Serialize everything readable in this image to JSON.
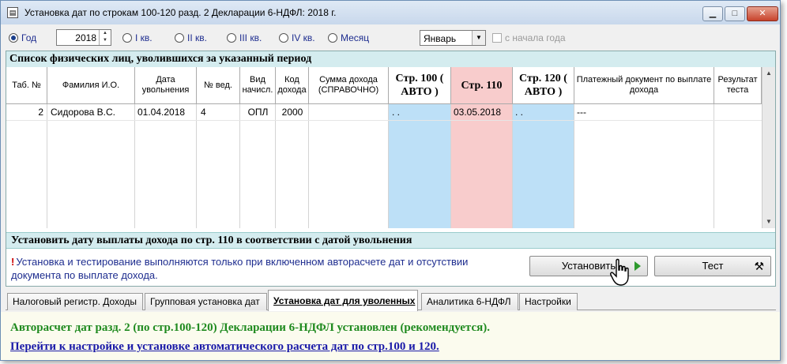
{
  "window": {
    "title": "Установка дат по строкам 100-120 разд. 2 Декларации 6-НДФЛ: 2018 г.",
    "minimize_glyph": "▁",
    "maximize_glyph": "□",
    "close_glyph": "✕"
  },
  "period": {
    "options": [
      {
        "label": "Год",
        "selected": true
      },
      {
        "label": "I кв.",
        "selected": false
      },
      {
        "label": "II кв.",
        "selected": false
      },
      {
        "label": "III кв.",
        "selected": false
      },
      {
        "label": "IV кв.",
        "selected": false
      },
      {
        "label": "Месяц",
        "selected": false
      }
    ],
    "year": "2018",
    "month": "Январь",
    "from_start_label": "с начала года",
    "from_start_checked": false
  },
  "list": {
    "title": "Список физических лиц, уволившихся за указанный период",
    "columns": [
      "Таб. №",
      "Фамилия И.О.",
      "Дата увольнения",
      "№ вед.",
      "Вид начисл.",
      "Код дохода",
      "Сумма дохода (СПРАВОЧНО)",
      "Стр. 100 ( АВТО )",
      "Стр. 110",
      "Стр. 120 ( АВТО )",
      "Платежный документ по выплате дохода",
      "Результат теста"
    ],
    "rows": [
      {
        "tab_no": "2",
        "name": "Сидорова В.С.",
        "dismissal_date": "01.04.2018",
        "ved_no": "4",
        "accrual_type": "ОПЛ",
        "income_code": "2000",
        "income_sum": "",
        "line100": ". .",
        "line110": "03.05.2018",
        "line120": ". .",
        "payment_doc": "---",
        "test_result": ""
      }
    ]
  },
  "set_date": {
    "title": "Установить дату выплаты дохода по стр. 110 в соответствии с датой увольнения",
    "warning_mark": "!",
    "note": "Установка и тестирование выполняются только при включенном авторасчете дат и отсутствии документа по выплате дохода.",
    "set_button": "Установить",
    "test_button": "Тест"
  },
  "tabs": [
    {
      "label": "Налоговый регистр. Доходы",
      "active": false
    },
    {
      "label": "Групповая установка дат",
      "active": false
    },
    {
      "label": "Установка дат для уволенных",
      "active": true
    },
    {
      "label": "Аналитика 6-НДФЛ",
      "active": false
    },
    {
      "label": "Настройки",
      "active": false
    }
  ],
  "footer": {
    "auto_message": "Авторасчет дат разд. 2 (по стр.100-120) Декларации 6-НДФЛ установлен (рекомендуется).",
    "link": "Перейти к настройке и установке автоматического расчета дат по стр.100 и 120."
  },
  "colors": {
    "auto_column": "#bde0f7",
    "line110_column": "#f8cccc",
    "panel_header": "#d4ecef",
    "footer_green": "#1f8a1f",
    "link_blue": "#1a1aa8"
  }
}
